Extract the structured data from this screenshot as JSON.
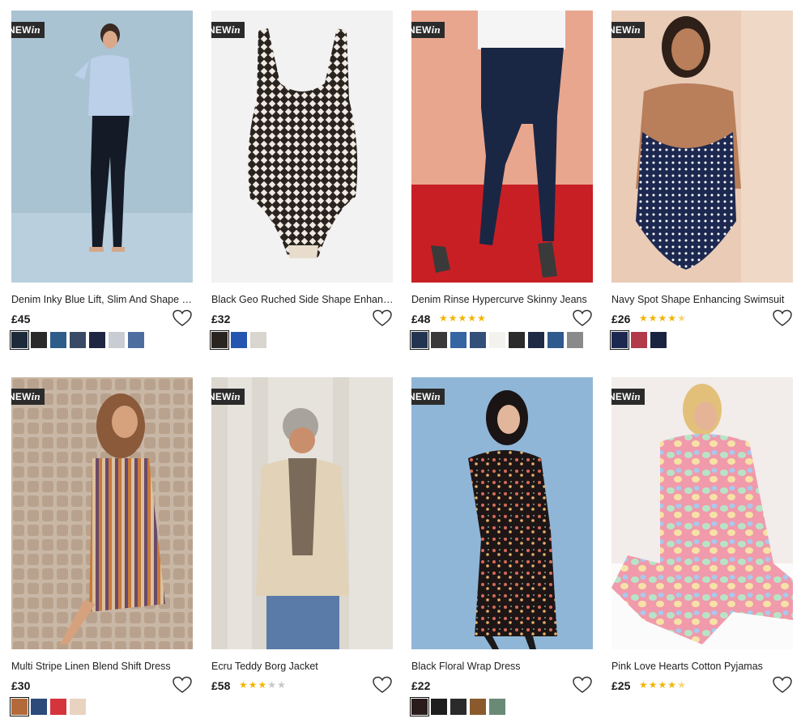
{
  "badge": {
    "new": "NEW",
    "in": "in"
  },
  "products": [
    {
      "title": "Denim Inky Blue Lift, Slim And Shape S...",
      "price": "£45",
      "rating": 0,
      "swatches": [
        "#1c2a3a",
        "#2a2a2a",
        "#2e5d8a",
        "#3a4a66",
        "#1e2642",
        "#c9ccd2",
        "#4f6ea0"
      ]
    },
    {
      "title": "Black Geo Ruched Side Shape Enhanci...",
      "price": "£32",
      "rating": 0,
      "swatches": [
        "#2a2420",
        "#2456b0",
        "#d9d5cf"
      ]
    },
    {
      "title": "Denim Rinse Hypercurve Skinny Jeans",
      "price": "£48",
      "rating": 5,
      "swatches": [
        "#22344f",
        "#3a3a3a",
        "#3665a3",
        "#34507a",
        "#f4f2ee",
        "#2b2b2b",
        "#1f2a44",
        "#2e5a8e",
        "#8a8a8a"
      ]
    },
    {
      "title": "Navy Spot Shape Enhancing Swimsuit",
      "price": "£26",
      "rating": 4.5,
      "swatches": [
        "#1c2850",
        "#b23a4a",
        "#1a2340"
      ]
    },
    {
      "title": "Multi Stripe Linen Blend Shift Dress",
      "price": "£30",
      "rating": 0,
      "swatches": [
        "#b26a3a",
        "#2c4a7a",
        "#d4343c",
        "#e8d3c0"
      ]
    },
    {
      "title": "Ecru Teddy Borg Jacket",
      "price": "£58",
      "rating": 3,
      "swatches": []
    },
    {
      "title": "Black Floral Wrap Dress",
      "price": "£22",
      "rating": 0,
      "swatches": [
        "#2a1c1c",
        "#1e1e1e",
        "#2b2b2b",
        "#8a5a2e",
        "#6a8a78"
      ]
    },
    {
      "title": "Pink Love Hearts Cotton Pyjamas",
      "price": "£25",
      "rating": 4.5,
      "swatches": []
    }
  ]
}
